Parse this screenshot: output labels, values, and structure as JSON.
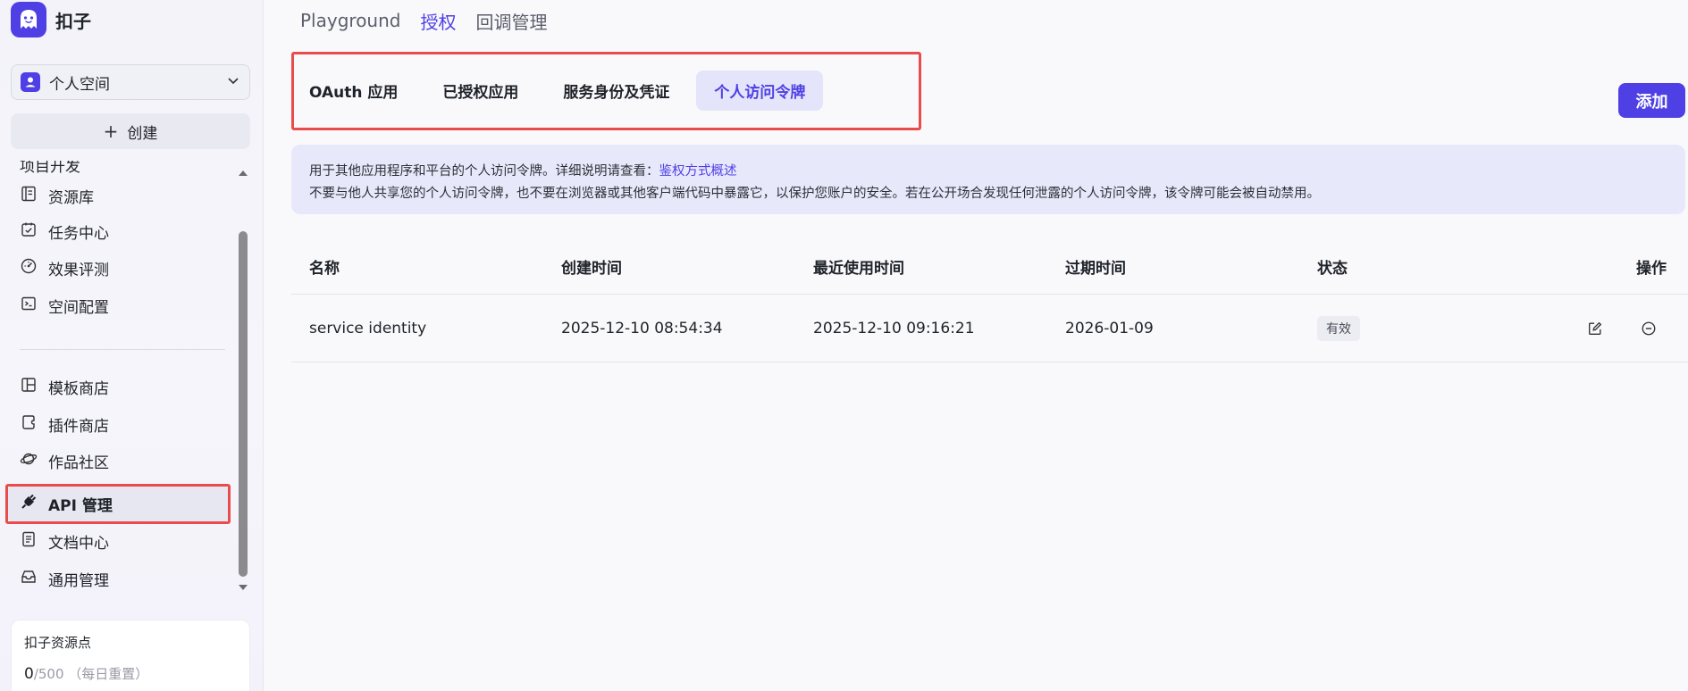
{
  "app": {
    "name": "扣子"
  },
  "workspace": {
    "name": "个人空间"
  },
  "sidebar": {
    "create_label": "创建",
    "partial_item": "项目开发",
    "items": [
      {
        "label": "资源库",
        "icon": "library-icon"
      },
      {
        "label": "任务中心",
        "icon": "task-icon"
      },
      {
        "label": "效果评测",
        "icon": "gauge-icon"
      },
      {
        "label": "空间配置",
        "icon": "terminal-icon"
      },
      {
        "label": "模板商店",
        "icon": "template-icon"
      },
      {
        "label": "插件商店",
        "icon": "plugin-icon"
      },
      {
        "label": "作品社区",
        "icon": "planet-icon"
      },
      {
        "label": "API 管理",
        "icon": "api-icon"
      },
      {
        "label": "文档中心",
        "icon": "doc-icon"
      },
      {
        "label": "通用管理",
        "icon": "inbox-icon"
      }
    ],
    "points": {
      "title": "扣子资源点",
      "used": "0",
      "total": "/500",
      "note": "（每日重置）"
    }
  },
  "top_tabs": [
    {
      "label": "Playground",
      "active": false
    },
    {
      "label": "授权",
      "active": true
    },
    {
      "label": "回调管理",
      "active": false
    }
  ],
  "sub_tabs": [
    {
      "label": "OAuth 应用",
      "active": false
    },
    {
      "label": "已授权应用",
      "active": false
    },
    {
      "label": "服务身份及凭证",
      "active": false
    },
    {
      "label": "个人访问令牌",
      "active": true
    }
  ],
  "add_button": "添加",
  "info": {
    "line1": "用于其他应用程序和平台的个人访问令牌。详细说明请查看：",
    "link": "鉴权方式概述",
    "line2": "不要与他人共享您的个人访问令牌，也不要在浏览器或其他客户端代码中暴露它，以保护您账户的安全。若在公开场合发现任何泄露的个人访问令牌，该令牌可能会被自动禁用。"
  },
  "table": {
    "headers": [
      "名称",
      "创建时间",
      "最近使用时间",
      "过期时间",
      "状态",
      "操作"
    ],
    "rows": [
      {
        "name": "service identity",
        "created": "2025-12-10 08:54:34",
        "last_used": "2025-12-10 09:16:21",
        "expires": "2026-01-09",
        "status": "有效"
      }
    ]
  },
  "colors": {
    "accent": "#4e40e5",
    "highlight": "#e84c4c"
  }
}
